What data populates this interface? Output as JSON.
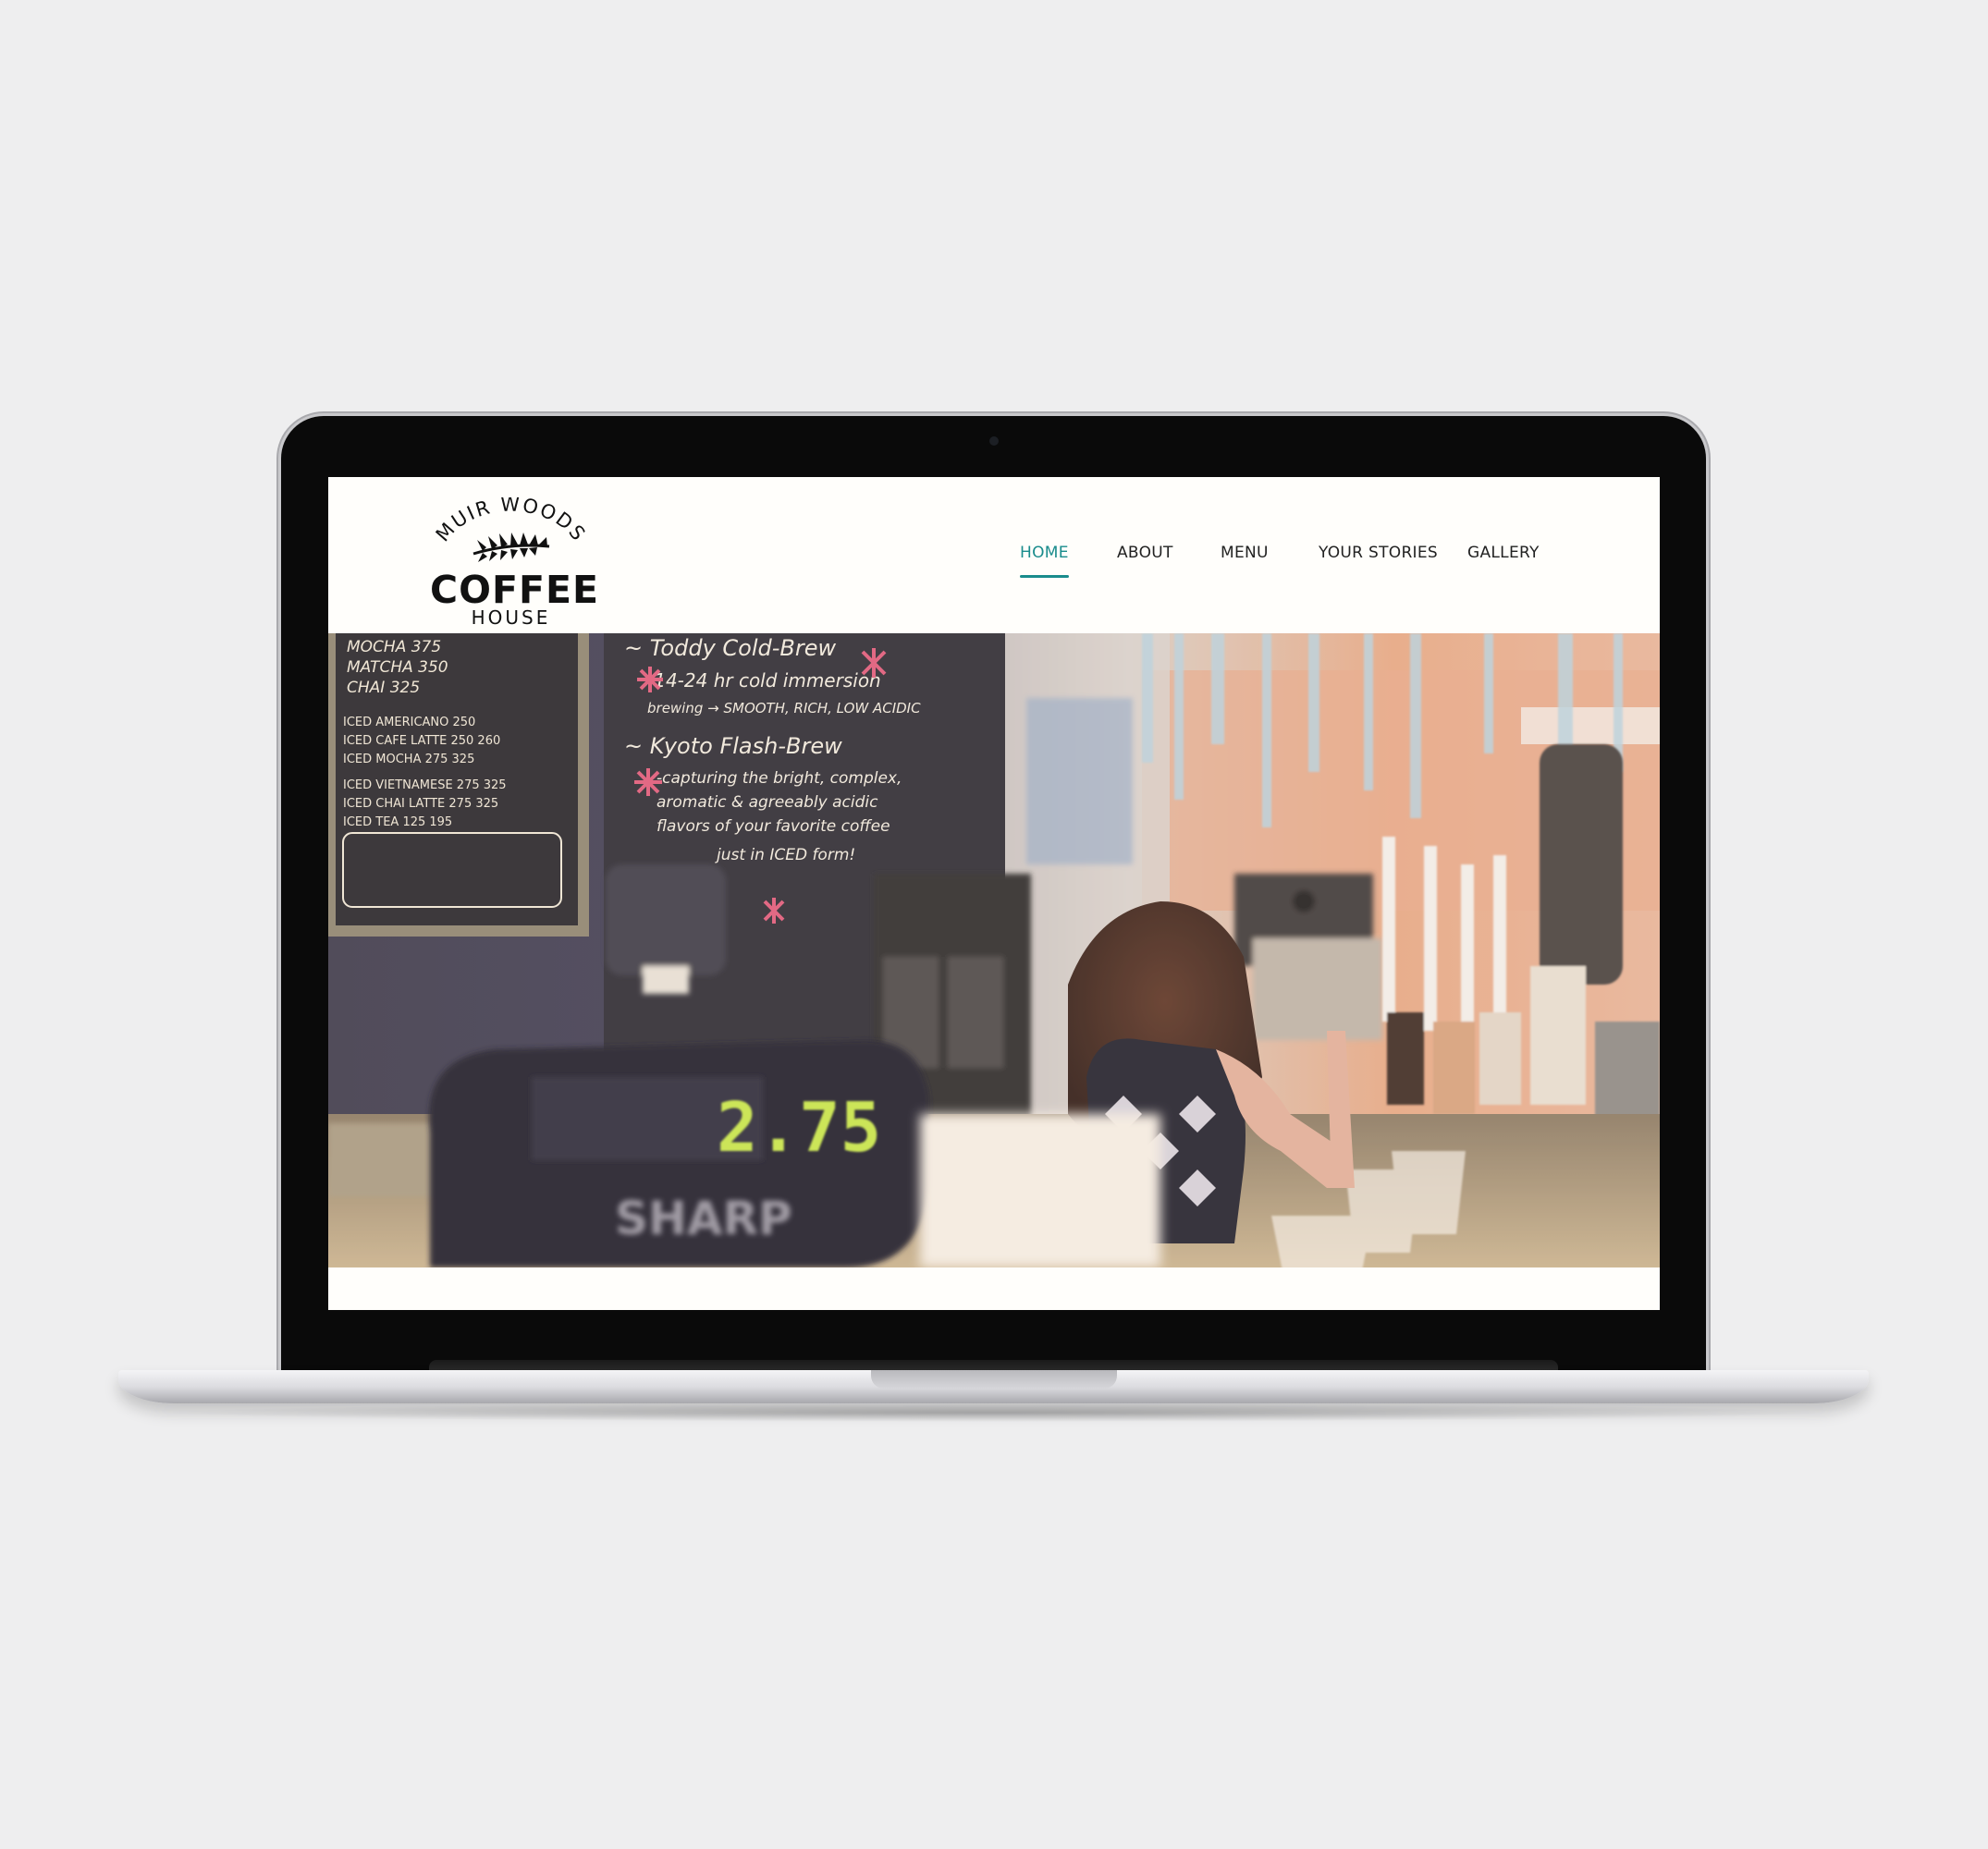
{
  "site": {
    "logo": {
      "arc_text": "MUIR WOODS",
      "main_text": "COFFEE",
      "sub_text": "HOUSE"
    },
    "nav": {
      "active": "HOME",
      "items": [
        {
          "label": "HOME"
        },
        {
          "label": "ABOUT"
        },
        {
          "label": "MENU"
        },
        {
          "label": "YOUR STORIES"
        },
        {
          "label": "GALLERY"
        }
      ]
    },
    "hero": {
      "menu_board_left": [
        "MOCHA 375",
        "MATCHA 350",
        "CHAI 325",
        "ICED AMERICANO 250",
        "ICED CAFE LATTE 250 260",
        "ICED MOCHA 275 325",
        "ICED VIETNAMESE 275 325",
        "ICED CHAI LATTE 275 325",
        "ICED TEA 125 195"
      ],
      "menu_board_right": [
        "~ Toddy Cold-Brew",
        "-14-24 hr cold immersion",
        "brewing → SMOOTH, RICH, LOW ACIDIC",
        "~ Kyoto Flash-Brew",
        "-capturing the bright, complex,",
        "aromatic & agreeably acidic",
        "flavors of your favorite coffee",
        "just in ICED form!"
      ],
      "register_display": "2.75",
      "register_brand": "SHARP"
    },
    "colors": {
      "accent": "#1a8c8c",
      "page_bg": "#eeeeef",
      "screen_bg": "#fffefb",
      "nav_text": "#222222"
    }
  }
}
